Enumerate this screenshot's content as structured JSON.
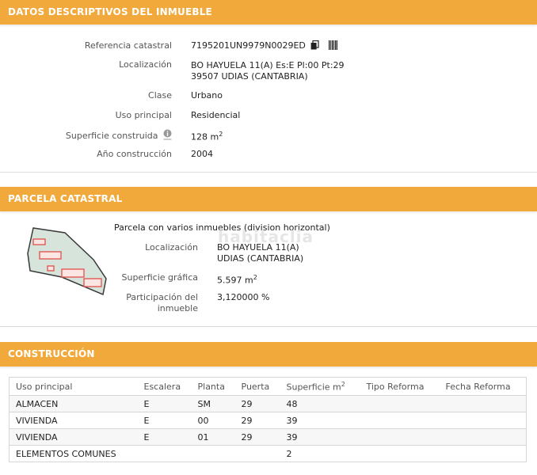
{
  "datos": {
    "header": "DATOS DESCRIPTIVOS DEL INMUEBLE",
    "referencia_label": "Referencia catastral",
    "referencia_value": "7195201UN9979N0029ED",
    "localizacion_label": "Localización",
    "localizacion_line1": "BO HAYUELA 11(A) Es:E Pl:00 Pt:29",
    "localizacion_line2": "39507 UDIAS (CANTABRIA)",
    "clase_label": "Clase",
    "clase_value": "Urbano",
    "uso_label": "Uso principal",
    "uso_value": "Residencial",
    "superficie_label": "Superficie construida",
    "superficie_value": "128 m",
    "superficie_unit_sup": "2",
    "anio_label": "Año construcción",
    "anio_value": "2004"
  },
  "parcela": {
    "header": "PARCELA CATASTRAL",
    "title": "Parcela con varios inmuebles (division horizontal)",
    "localizacion_label": "Localización",
    "localizacion_line1": "BO HAYUELA 11(A)",
    "localizacion_line2": "UDIAS (CANTABRIA)",
    "superficie_label": "Superficie gráfica",
    "superficie_value": "5.597 m",
    "superficie_unit_sup": "2",
    "participacion_label_line1": "Participación del",
    "participacion_label_line2": "inmueble",
    "participacion_value": "3,120000 %",
    "watermark": "habitaclia"
  },
  "construccion": {
    "header": "CONSTRUCCIÓN",
    "columns": [
      "Uso principal",
      "Escalera",
      "Planta",
      "Puerta",
      "Superficie m",
      "Tipo Reforma",
      "Fecha Reforma"
    ],
    "superficie_unit_sup": "2",
    "rows": [
      [
        "ALMACEN",
        "E",
        "SM",
        "29",
        "48",
        "",
        ""
      ],
      [
        "VIVIENDA",
        "E",
        "00",
        "29",
        "39",
        "",
        ""
      ],
      [
        "VIVIENDA",
        "E",
        "01",
        "29",
        "39",
        "",
        ""
      ],
      [
        "ELEMENTOS COMUNES",
        "",
        "",
        "",
        "2",
        "",
        ""
      ]
    ]
  },
  "colors": {
    "header_bg": "#f2a93b",
    "parcel_fill": "#d6e4dc",
    "building_red": "#e0504a"
  }
}
